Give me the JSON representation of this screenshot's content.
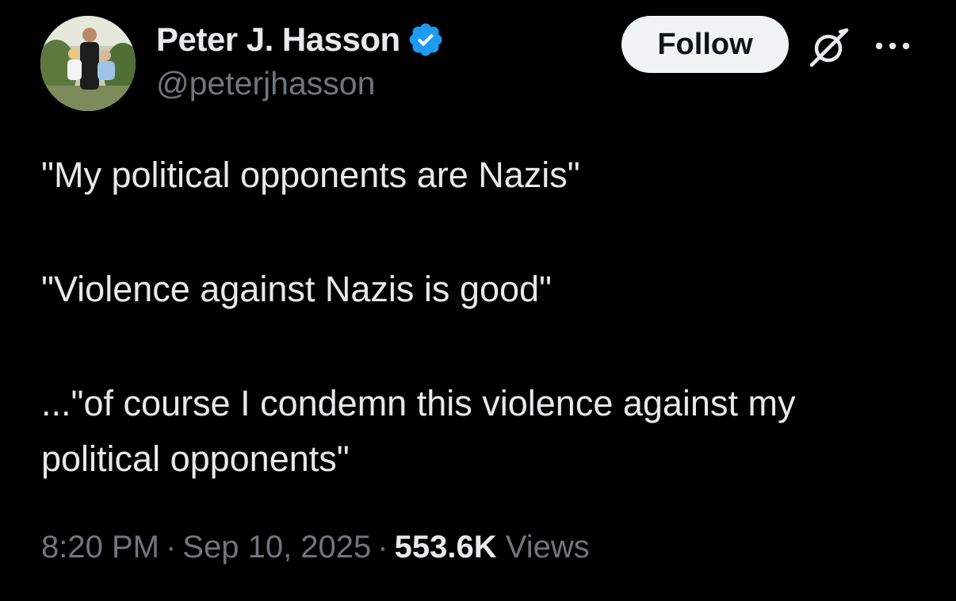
{
  "author": {
    "display_name": "Peter J. Hasson",
    "handle": "@peterjhasson",
    "verified_icon": "verified-badge-icon",
    "avatar_icon": "avatar-photo"
  },
  "actions": {
    "follow_label": "Follow",
    "grok_icon": "grok-icon",
    "more_icon": "more-options-icon"
  },
  "tweet": {
    "paragraphs": [
      "\"My political opponents are Nazis\"",
      "\"Violence against Nazis is good\"",
      "...\"of course I condemn this violence against my political opponents\""
    ]
  },
  "meta": {
    "time": "8:20 PM",
    "date": "Sep 10, 2025",
    "separator": "·",
    "views_count": "553.6K",
    "views_label": "Views"
  },
  "colors": {
    "background": "#000000",
    "text_primary": "#e7e9ea",
    "text_secondary": "#71767b",
    "verified_blue": "#1d9bf0",
    "follow_bg": "#eff3f4"
  }
}
